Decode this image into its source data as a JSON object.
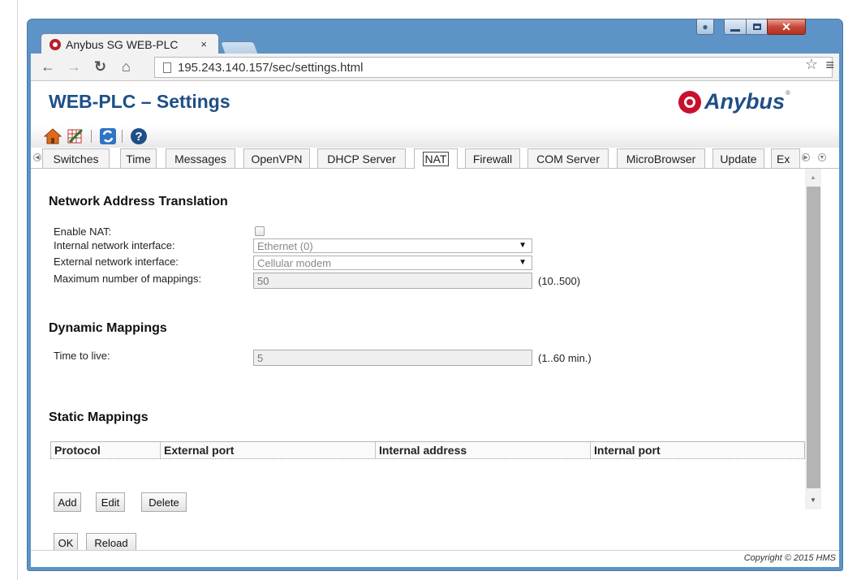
{
  "browser": {
    "tab_title": "Anybus SG WEB-PLC",
    "tab_close": "×",
    "address": "195.243.140.157/sec/settings.html"
  },
  "header": {
    "title": "WEB-PLC – Settings",
    "logo_text": "Anybus",
    "logo_reg": "®"
  },
  "tabs": [
    {
      "label": "Switches"
    },
    {
      "label": "Time"
    },
    {
      "label": "Messages"
    },
    {
      "label": "OpenVPN"
    },
    {
      "label": "DHCP Server"
    },
    {
      "label": "NAT",
      "active": true
    },
    {
      "label": "Firewall"
    },
    {
      "label": "COM Server"
    },
    {
      "label": "MicroBrowser"
    },
    {
      "label": "Update"
    },
    {
      "label": "Ex"
    }
  ],
  "nat": {
    "section_title": "Network Address Translation",
    "enable_label": "Enable NAT:",
    "enable_checked": false,
    "internal_label": "Internal network interface:",
    "internal_value": "Ethernet (0)",
    "external_label": "External network interface:",
    "external_value": "Cellular modem",
    "max_label": "Maximum number of mappings:",
    "max_value": "50",
    "max_hint": "(10..500)"
  },
  "dynamic": {
    "section_title": "Dynamic Mappings",
    "ttl_label": "Time to live:",
    "ttl_value": "5",
    "ttl_hint": "(1..60 min.)"
  },
  "static": {
    "section_title": "Static Mappings",
    "columns": [
      "Protocol",
      "External port",
      "Internal address",
      "Internal port"
    ],
    "add_label": "Add",
    "edit_label": "Edit",
    "delete_label": "Delete"
  },
  "actions": {
    "ok_label": "OK",
    "reload_label": "Reload"
  },
  "footer": {
    "copyright": "Copyright © 2015 HMS"
  },
  "colors": {
    "title": "#1e4f86",
    "window_frame": "#5d93c6",
    "close_button": "#c7483a"
  }
}
